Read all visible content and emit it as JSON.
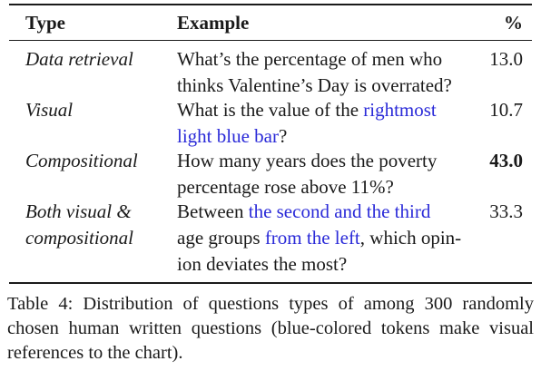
{
  "table": {
    "headers": {
      "type": "Type",
      "example": "Example",
      "percent": "%"
    },
    "rows": [
      {
        "type_lines": [
          "Data retrieval"
        ],
        "example_lines": [
          [
            {
              "text": "What’s the percentage of men who",
              "blue": false
            }
          ],
          [
            {
              "text": "thinks Valentine’s Day is overrated?",
              "blue": false
            }
          ]
        ],
        "percent": "13.0",
        "percent_bold": false
      },
      {
        "type_lines": [
          "Visual"
        ],
        "example_lines": [
          [
            {
              "text": "What is the value of the ",
              "blue": false
            },
            {
              "text": "rightmost",
              "blue": true
            }
          ],
          [
            {
              "text": "light blue bar",
              "blue": true
            },
            {
              "text": "?",
              "blue": false
            }
          ]
        ],
        "percent": "10.7",
        "percent_bold": false
      },
      {
        "type_lines": [
          "Compositional"
        ],
        "example_lines": [
          [
            {
              "text": "How many years does the poverty",
              "blue": false
            }
          ],
          [
            {
              "text": "percentage rose above 11%?",
              "blue": false
            }
          ]
        ],
        "percent": "43.0",
        "percent_bold": true
      },
      {
        "type_lines": [
          "Both visual &",
          "compositional"
        ],
        "example_lines": [
          [
            {
              "text": "Between ",
              "blue": false
            },
            {
              "text": "the second and the third",
              "blue": true
            }
          ],
          [
            {
              "text": "age groups ",
              "blue": false
            },
            {
              "text": "from the left",
              "blue": true
            },
            {
              "text": ", which opin-",
              "blue": false
            }
          ],
          [
            {
              "text": "ion deviates the most?",
              "blue": false
            }
          ]
        ],
        "percent": "33.3",
        "percent_bold": false
      }
    ]
  },
  "caption": {
    "label": "Table 4:",
    "text": "Distribution of questions types of among 300 randomly chosen human written questions (blue-colored tokens make visual references to the chart)."
  }
}
